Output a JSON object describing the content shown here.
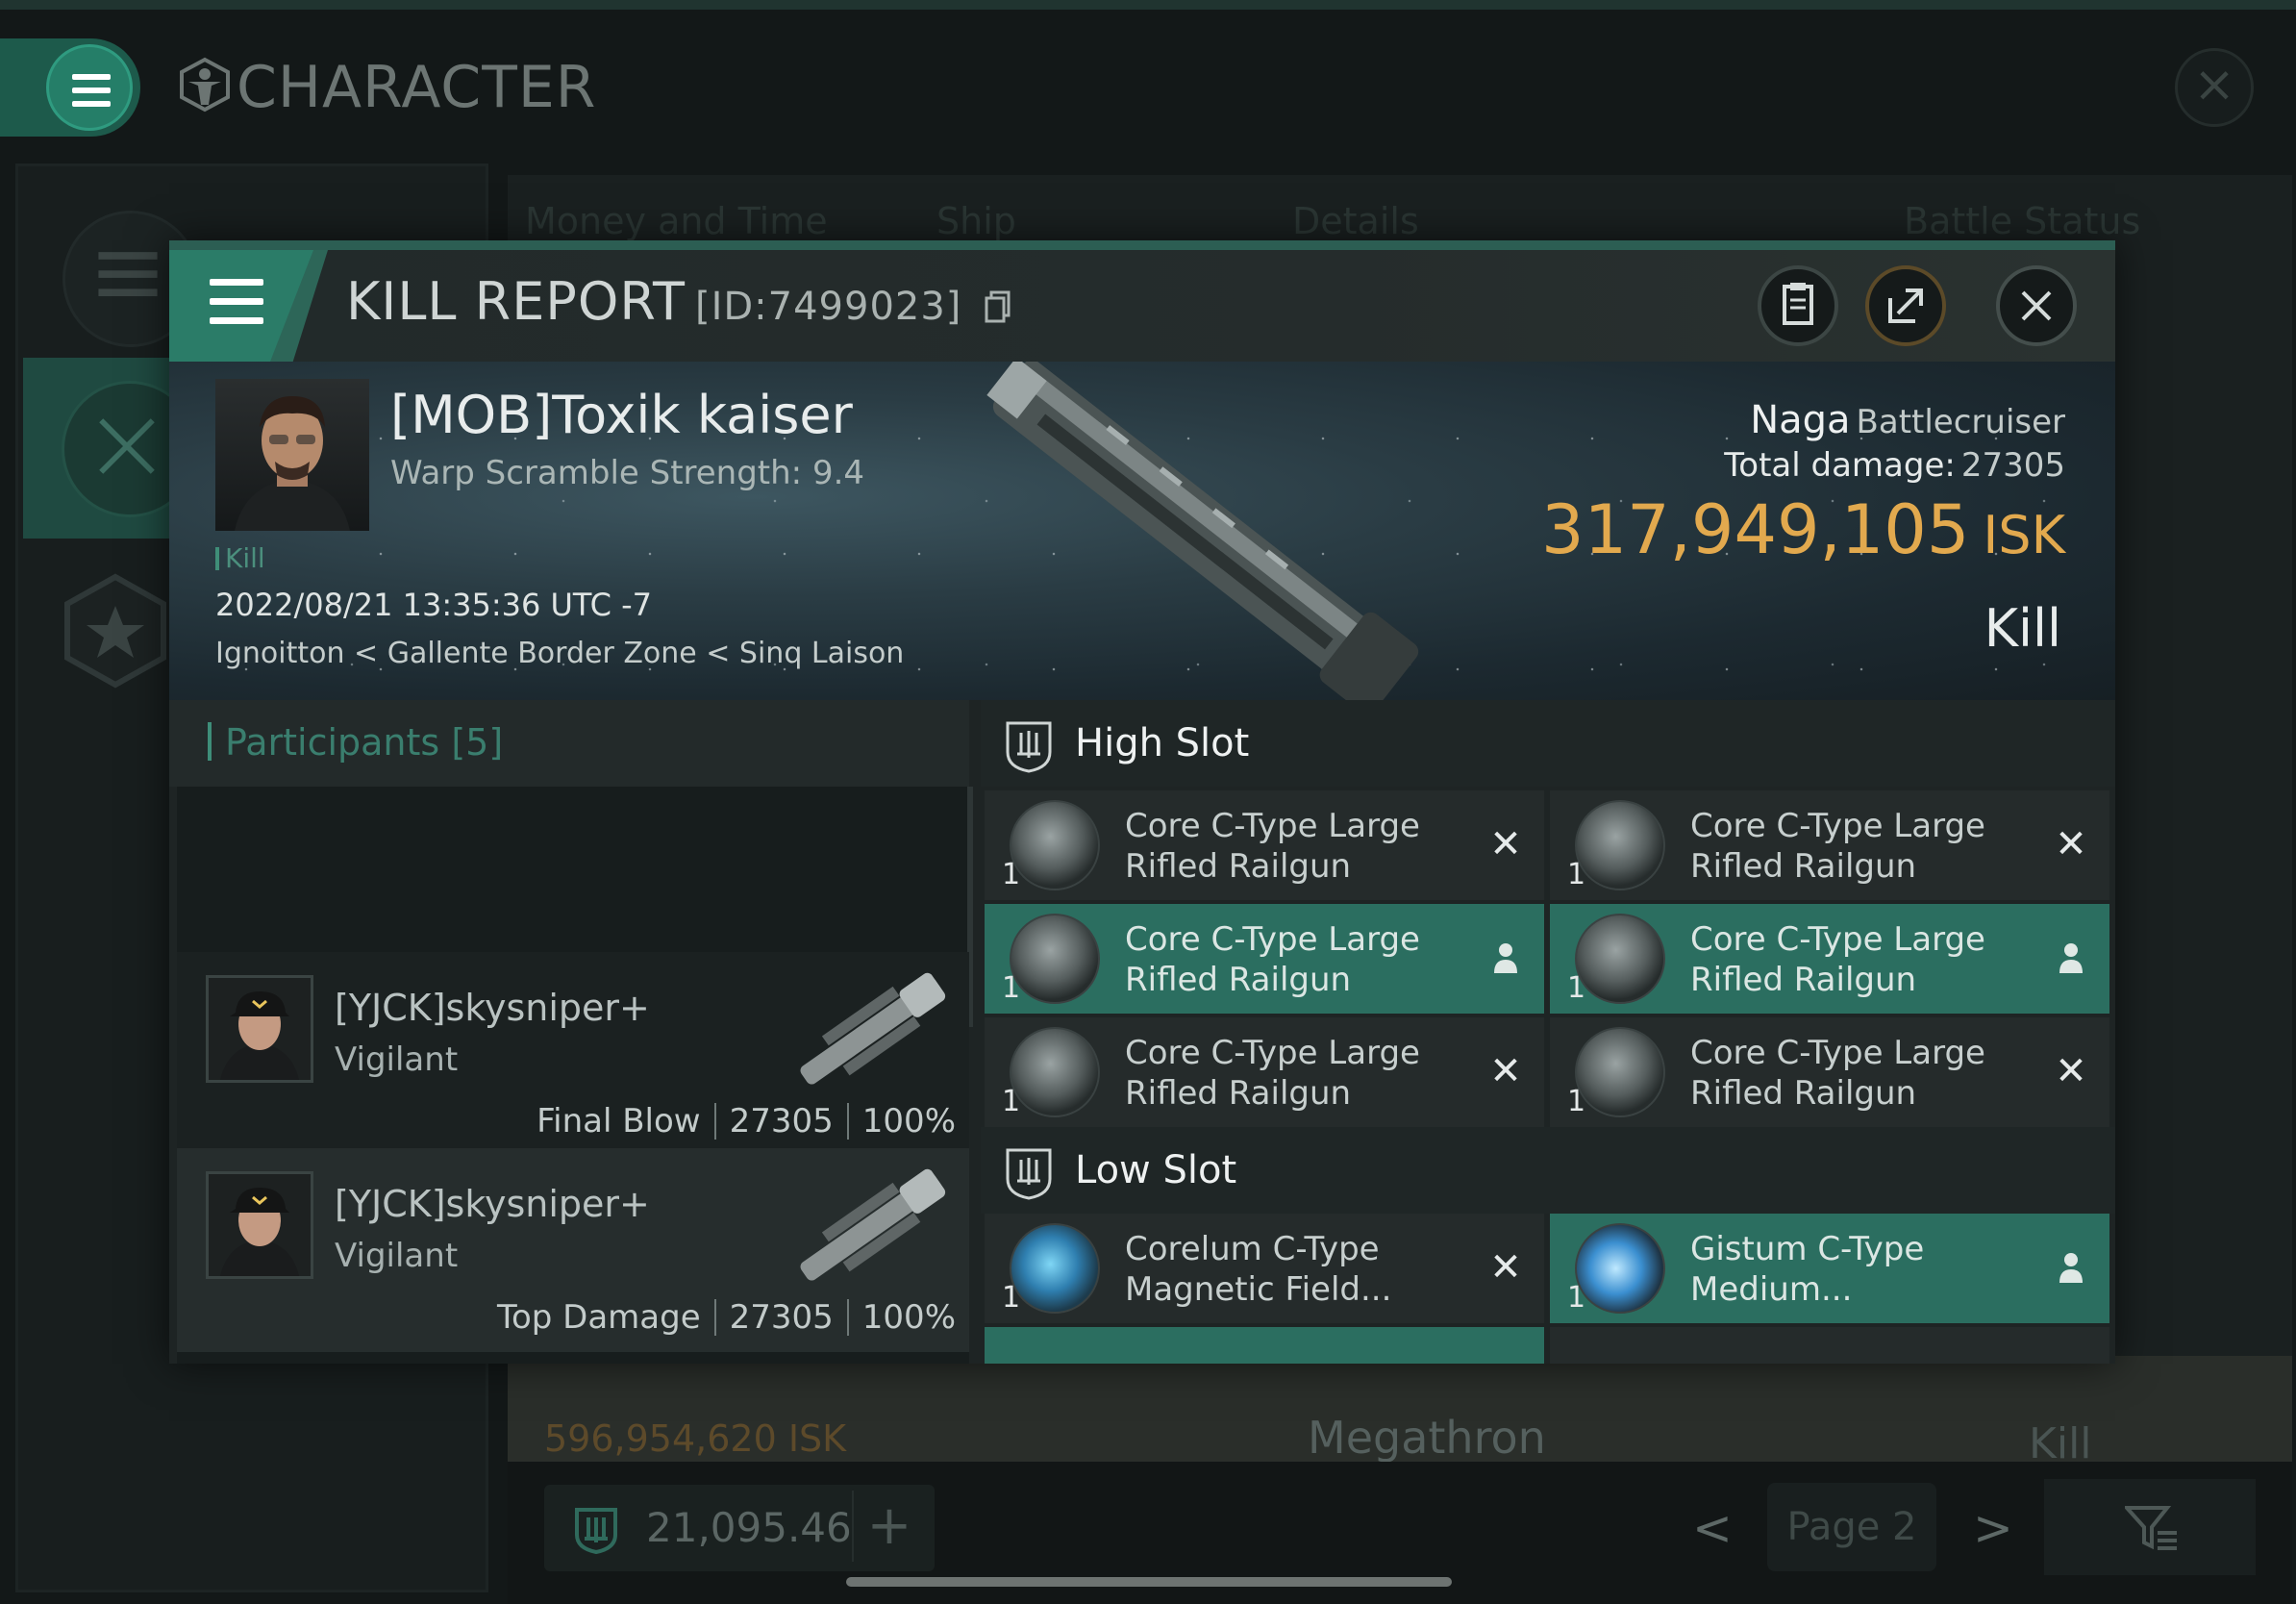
{
  "app": {
    "title": "CHARACTER"
  },
  "background": {
    "columns": [
      "Money and Time",
      "Ship",
      "Details",
      "Battle Status"
    ],
    "row": {
      "isk": "596,954,620",
      "isk_unit": "ISK",
      "ship": "Megathron",
      "status": "Kill"
    },
    "wallet": {
      "amount": "21,095.46"
    },
    "pager": {
      "label": "Page 2"
    }
  },
  "kill_report": {
    "title": "KILL REPORT",
    "id": "[ID:7499023]",
    "pilot": {
      "name": "[MOB]Toxik kaiser",
      "warp_scramble": "Warp Scramble Strength: 9.4"
    },
    "tag": "Kill",
    "datetime": "2022/08/21 13:35:36 UTC -7",
    "location": "Ignoitton < Gallente Border Zone < Sinq Laison",
    "ship": {
      "name": "Naga",
      "class": "Battlecruiser"
    },
    "total_damage_label": "Total damage:",
    "total_damage": "27305",
    "isk_value": "317,949,105",
    "isk_unit": "ISK",
    "result": "Kill"
  },
  "participants": {
    "title": "Participants",
    "count": "[5]",
    "items": [
      {
        "name": "[YJCK]skysniper+",
        "ship": "Vigilant",
        "role": "Final Blow",
        "damage": "27305",
        "percent": "100%"
      },
      {
        "name": "[YJCK]skysniper+",
        "ship": "Vigilant",
        "role": "Top Damage",
        "damage": "27305",
        "percent": "100%"
      }
    ]
  },
  "fitting": {
    "high_slot": {
      "title": "High Slot",
      "modules": [
        {
          "name_line1": "Core C-Type Large",
          "name_line2": "Rifled Railgun",
          "qty": "1",
          "status": "destroyed",
          "status_icon": "close-icon"
        },
        {
          "name_line1": "Core C-Type Large",
          "name_line2": "Rifled Railgun",
          "qty": "1",
          "status": "destroyed",
          "status_icon": "close-icon"
        },
        {
          "name_line1": "Core C-Type Large",
          "name_line2": "Rifled Railgun",
          "qty": "1",
          "status": "dropped",
          "status_icon": "person-icon"
        },
        {
          "name_line1": "Core C-Type Large",
          "name_line2": "Rifled Railgun",
          "qty": "1",
          "status": "dropped",
          "status_icon": "person-icon"
        },
        {
          "name_line1": "Core C-Type Large",
          "name_line2": "Rifled Railgun",
          "qty": "1",
          "status": "destroyed",
          "status_icon": "close-icon"
        },
        {
          "name_line1": "Core C-Type Large",
          "name_line2": "Rifled Railgun",
          "qty": "1",
          "status": "destroyed",
          "status_icon": "close-icon"
        }
      ]
    },
    "low_slot": {
      "title": "Low Slot",
      "modules": [
        {
          "name_line1": "Corelum C-Type",
          "name_line2": "Magnetic Field...",
          "qty": "1",
          "status": "destroyed",
          "status_icon": "close-icon"
        },
        {
          "name_line1": "Gistum C-Type",
          "name_line2": "Medium...",
          "qty": "1",
          "status": "dropped",
          "status_icon": "person-icon"
        }
      ]
    }
  },
  "colors": {
    "accent": "#2b7c68",
    "isk_gold": "#e2a94e",
    "dropped_bg": "#2b6e60"
  }
}
